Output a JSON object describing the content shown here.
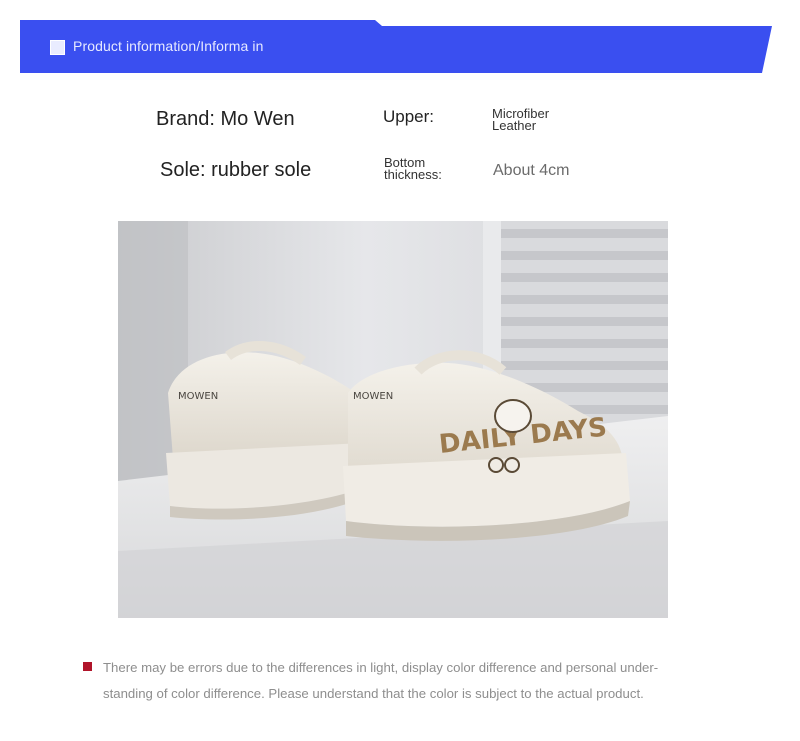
{
  "banner": {
    "title": "Product information/Informa in",
    "color": "#3a4ff0"
  },
  "specs": {
    "brand": "Brand: Mo Wen",
    "sole": "Sole: rubber sole",
    "upper_label": "Upper:",
    "upper_value_line1": "Microfiber",
    "upper_value_line2": "Leather",
    "thickness_label_line1": "Bottom",
    "thickness_label_line2": "thickness:",
    "thickness_value": "About 4cm"
  },
  "photo": {
    "icon": "sneaker-photo",
    "logo_left": "MOWEN",
    "logo_right": "MOWEN",
    "print_text": "DAILY DAYS"
  },
  "note": {
    "accent": "#b0142a",
    "line1": "There may be errors due to the differences in light, display color difference and personal under-",
    "line2": "standing of color difference. Please understand that the color is subject to the actual product."
  }
}
